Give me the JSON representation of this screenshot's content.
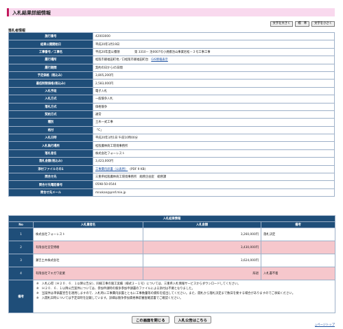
{
  "header": {
    "title": "入札結果詳細情報"
  },
  "text_size": {
    "larger": "文字を大きく",
    "standard": "標　準",
    "smaller": "文字を小さく"
  },
  "section": {
    "label": "落札者情報"
  },
  "info": [
    {
      "k": "施行番号",
      "v": "42003000"
    },
    {
      "k": "結果公開開始日",
      "v": "平成20年3月19日"
    },
    {
      "k": "工事番号／工事名",
      "v": "平成20年度公積領　　　　　第 3310－ 治0007号小規模治山事業岩松－３号工事工事"
    },
    {
      "k": "履行場所",
      "v": "松阪市飯福田町地／口松阪市飯福田町台",
      "link": "GIS情報表示"
    },
    {
      "k": "履行期間",
      "v": "契約の日から45日間"
    },
    {
      "k": "予定価格（税込み）",
      "v": "3,805,200円"
    },
    {
      "k": "最低制限価格(税込み)",
      "v": "2,583,000円"
    },
    {
      "k": "入札手段",
      "v": "電子入札"
    },
    {
      "k": "入札方式",
      "v": "一般競争入札"
    },
    {
      "k": "落札方式",
      "v": "価格競争"
    },
    {
      "k": "契約方式",
      "v": "通常"
    },
    {
      "k": "種別",
      "v": "土木一式工事"
    },
    {
      "k": "格付",
      "v": "「C」"
    },
    {
      "k": "入札日時",
      "v": "平成20年3月1日 午前10時00分"
    },
    {
      "k": "入札執行場所",
      "v": "松阪農林商工環境事務所"
    },
    {
      "k": "落札者名",
      "v": "株式会社フォーレスト"
    },
    {
      "k": "落札金額(税込み)",
      "v": "3,423,000円"
    },
    {
      "k": "添付ファイルその1",
      "v": "",
      "link": "工事費内訳書（公表用）",
      "suffix": "(PDF 9 KB)"
    },
    {
      "k": "問合せ先",
      "v": "三重県松阪農林商工環境事務所　総務企画室　総務課"
    },
    {
      "k": "問合せ先電話番号",
      "v": "0598-50-0544"
    },
    {
      "k": "問合せ先メール",
      "v": "mnokan@pref.mie.jp"
    }
  ],
  "results": {
    "heading": "入札結果情報",
    "cols": {
      "no": "No",
      "name": "入札業者名",
      "amount": "入札金額",
      "remarks": "備考"
    },
    "rows": [
      {
        "no": "1",
        "name": "株式会社フォーレスト",
        "amount": "3,260,000円",
        "remarks": "落札決定",
        "pink": false
      },
      {
        "no": "2",
        "name": "有限会社宮堂博樹",
        "amount": "3,430,000円",
        "remarks": "",
        "pink": true
      },
      {
        "no": "3",
        "name": "瀬吉土木株式会社",
        "amount": "3,624,000円",
        "remarks": "",
        "pink": false
      },
      {
        "no": "4",
        "name": "有限会社マエガワ産業",
        "amount": "辞退",
        "remarks": "入札書不着",
        "pink": true
      }
    ],
    "notes_label": "備考",
    "notes": [
      "※　入札心得（Ｈ２０．６．１以降公告分）、同様工事の施工実績（様式２－１号）については、三重県入札情報サービスからダウンロードしてください。",
      "※　Ｈ２０．６．１以降公告案件については、参加申請時の競争参加申請書のファイルによる添付は不要となりました。",
      "※　当案件は単価書宣告を適用しますので、入札時に工事費内訳書とともに工事数量等の資料を提出してください。また、開札から落札決定まで数日を要する場合がありますのでご承知ください。",
      "※　入開札日時については予定日時を記載しています。詳細は競争参加資格事前審査確認書でご確認ください。"
    ]
  },
  "footer": {
    "close": "この画面を閉じる",
    "notice": "入札公告はこちら",
    "pagetop": "△ページトップ"
  }
}
